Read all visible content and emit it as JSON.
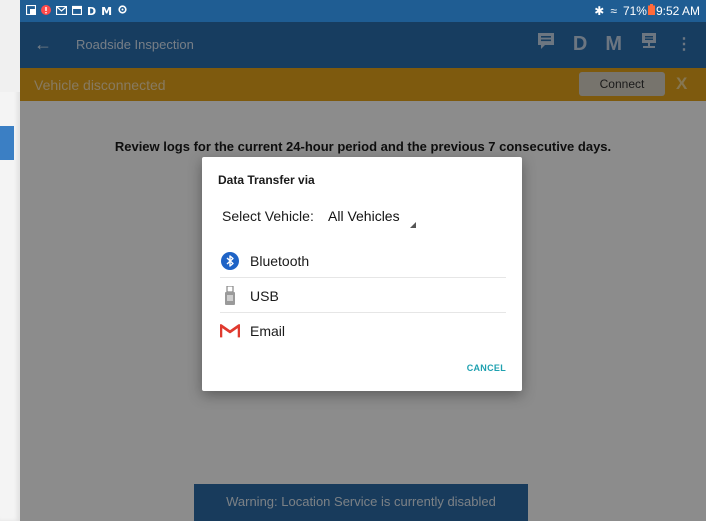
{
  "status_bar": {
    "left_icons": [
      "image-icon",
      "alert-icon",
      "mail-icon",
      "calendar-icon",
      "d-icon",
      "m-icon",
      "settings-icon"
    ],
    "left_text": {
      "d": "D",
      "m": "M"
    },
    "bluetooth_glyph": "✱",
    "wifi_glyph": "≈",
    "battery": "71%",
    "time": "9:52 AM"
  },
  "app_bar": {
    "back_glyph": "←",
    "title": "Roadside Inspection",
    "actions": {
      "d_label": "D",
      "m_label": "M",
      "more_glyph": "⋮"
    }
  },
  "banner": {
    "message": "Vehicle disconnected",
    "connect_label": "Connect",
    "close_label": "X"
  },
  "content": {
    "review_text": "Review logs for the current 24-hour period and the previous 7 consecutive days.",
    "warning": "Warning: Location Service is currently disabled"
  },
  "dialog": {
    "title": "Data Transfer via",
    "select_label": "Select Vehicle:",
    "select_value": "All Vehicles",
    "options": [
      {
        "label": "Bluetooth",
        "icon": "bluetooth-icon"
      },
      {
        "label": "USB",
        "icon": "usb-icon"
      },
      {
        "label": "Email",
        "icon": "gmail-icon"
      }
    ],
    "cancel_label": "CANCEL"
  },
  "colors": {
    "app_bar": "#2a6fb0",
    "status_bar": "#1f5d93",
    "banner": "#e6a51a",
    "accent": "#1fa1b0",
    "warning_bar": "#2c6ca8"
  }
}
